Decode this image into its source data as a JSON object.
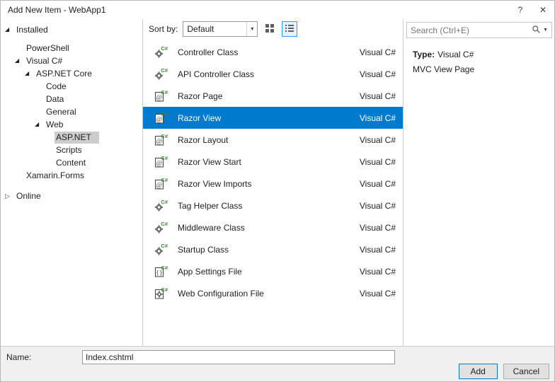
{
  "window": {
    "title": "Add New Item - WebApp1",
    "help_label": "?",
    "close_label": "✕"
  },
  "tree": {
    "items": [
      {
        "label": "Installed",
        "level": 0,
        "state": "expanded",
        "selected": false,
        "gap_after": true
      },
      {
        "label": "PowerShell",
        "level": 1,
        "state": "leaf",
        "selected": false
      },
      {
        "label": "Visual C#",
        "level": 1,
        "state": "expanded",
        "selected": false
      },
      {
        "label": "ASP.NET Core",
        "level": 2,
        "state": "expanded",
        "selected": false
      },
      {
        "label": "Code",
        "level": 3,
        "state": "leaf",
        "selected": false
      },
      {
        "label": "Data",
        "level": 3,
        "state": "leaf",
        "selected": false
      },
      {
        "label": "General",
        "level": 3,
        "state": "leaf",
        "selected": false
      },
      {
        "label": "Web",
        "level": 3,
        "state": "expanded",
        "selected": false
      },
      {
        "label": "ASP.NET",
        "level": 4,
        "state": "leaf",
        "selected": true
      },
      {
        "label": "Scripts",
        "level": 4,
        "state": "leaf",
        "selected": false
      },
      {
        "label": "Content",
        "level": 4,
        "state": "leaf",
        "selected": false
      },
      {
        "label": "Xamarin.Forms",
        "level": 1,
        "state": "leaf",
        "selected": false
      },
      {
        "label": "Online",
        "level": 0,
        "state": "collapsed",
        "selected": false,
        "gap_before": true
      }
    ]
  },
  "toolbar": {
    "sort_label": "Sort by:",
    "sort_value": "Default"
  },
  "search": {
    "placeholder": "Search (Ctrl+E)"
  },
  "templates": {
    "items": [
      {
        "label": "Controller Class",
        "language": "Visual C#",
        "icon": "gear-icon",
        "selected": false
      },
      {
        "label": "API Controller Class",
        "language": "Visual C#",
        "icon": "gear-icon",
        "selected": false
      },
      {
        "label": "Razor Page",
        "language": "Visual C#",
        "icon": "razor-page-icon",
        "selected": false
      },
      {
        "label": "Razor View",
        "language": "Visual C#",
        "icon": "razor-page-icon",
        "selected": true
      },
      {
        "label": "Razor Layout",
        "language": "Visual C#",
        "icon": "razor-page-icon",
        "selected": false
      },
      {
        "label": "Razor View Start",
        "language": "Visual C#",
        "icon": "razor-page-icon",
        "selected": false
      },
      {
        "label": "Razor View Imports",
        "language": "Visual C#",
        "icon": "razor-page-icon",
        "selected": false
      },
      {
        "label": "Tag Helper Class",
        "language": "Visual C#",
        "icon": "gear-icon",
        "selected": false
      },
      {
        "label": "Middleware Class",
        "language": "Visual C#",
        "icon": "gear-icon",
        "selected": false
      },
      {
        "label": "Startup Class",
        "language": "Visual C#",
        "icon": "gear-icon",
        "selected": false
      },
      {
        "label": "App Settings File",
        "language": "Visual C#",
        "icon": "settings-file-icon",
        "selected": false
      },
      {
        "label": "Web Configuration File",
        "language": "Visual C#",
        "icon": "config-file-icon",
        "selected": false
      }
    ]
  },
  "details": {
    "type_label": "Type:",
    "type_value": "Visual C#",
    "description": "MVC View Page"
  },
  "footer": {
    "name_label": "Name:",
    "name_value": "Index.cshtml",
    "add_label": "Add",
    "cancel_label": "Cancel"
  },
  "colors": {
    "selection_background": "#007acc",
    "selected_category_background": "#cccccc",
    "default_button_border": "#007acc"
  }
}
